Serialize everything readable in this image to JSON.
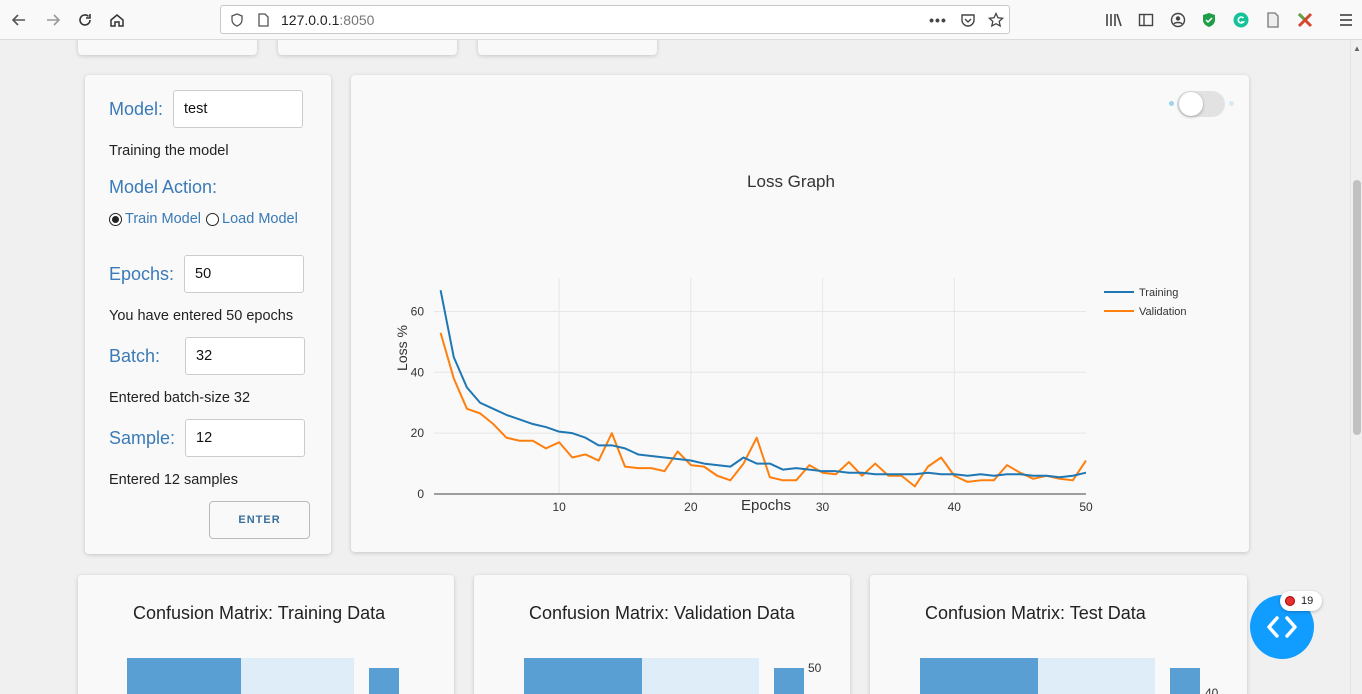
{
  "browser": {
    "url_host": "127.0.0.1",
    "url_port": ":8050"
  },
  "control_panel": {
    "model_label": "Model:",
    "model_value": "test",
    "model_status": "Training the model",
    "action_label": "Model Action:",
    "action_options": [
      "Train Model",
      "Load Model"
    ],
    "action_selected": "Train Model",
    "epochs_label": "Epochs:",
    "epochs_value": "50",
    "epochs_status": "You have entered 50 epochs",
    "batch_label": "Batch:",
    "batch_value": "32",
    "batch_status": "Entered batch-size 32",
    "sample_label": "Sample:",
    "sample_value": "12",
    "sample_status": "Entered 12 samples",
    "enter_label": "ENTER"
  },
  "toggle": {
    "on": false
  },
  "chart_data": {
    "type": "line",
    "title": "Loss Graph",
    "xlabel": "Epochs",
    "ylabel": "Loss %",
    "xlim": [
      0.5,
      50
    ],
    "ylim": [
      0,
      71
    ],
    "xticks": [
      10,
      20,
      30,
      40,
      50
    ],
    "yticks": [
      0,
      20,
      40,
      60
    ],
    "grid": true,
    "legend_position": "top-right",
    "x": [
      1,
      2,
      3,
      4,
      5,
      6,
      7,
      8,
      9,
      10,
      11,
      12,
      13,
      14,
      15,
      16,
      17,
      18,
      19,
      20,
      21,
      22,
      23,
      24,
      25,
      26,
      27,
      28,
      29,
      30,
      31,
      32,
      33,
      34,
      35,
      36,
      37,
      38,
      39,
      40,
      41,
      42,
      43,
      44,
      45,
      46,
      47,
      48,
      49,
      50
    ],
    "series": [
      {
        "name": "Training",
        "color": "#1f77b4",
        "values": [
          67,
          45,
          35,
          30,
          28,
          26,
          24.5,
          23,
          22,
          20.5,
          20,
          18.5,
          16,
          16,
          15,
          13,
          12.5,
          12,
          11.5,
          11,
          10,
          9.5,
          9,
          12,
          10,
          10,
          8,
          8.5,
          8,
          7.5,
          7.5,
          7,
          7,
          6.5,
          6.5,
          6.5,
          6.5,
          7,
          6.5,
          6.5,
          6,
          6.5,
          6,
          6.5,
          6.5,
          6,
          6,
          5.5,
          6,
          7
        ]
      },
      {
        "name": "Validation",
        "color": "#ff7f0e",
        "values": [
          53,
          38,
          28,
          26.5,
          23,
          18.5,
          17.5,
          17.5,
          15,
          17,
          12,
          13,
          11,
          20,
          9,
          8.5,
          8.5,
          7.5,
          14,
          9.5,
          9,
          6,
          4.5,
          10,
          18.5,
          5.5,
          4.5,
          4.5,
          9.5,
          7,
          6.5,
          10.5,
          6,
          10,
          6,
          6,
          2.5,
          9,
          12,
          6,
          4,
          4.5,
          4.5,
          9.5,
          7,
          5,
          6,
          5,
          4.5,
          11
        ]
      }
    ]
  },
  "confusion_matrices": [
    {
      "title": "Confusion Matrix: Training Data",
      "scale_label": ""
    },
    {
      "title": "Confusion Matrix: Validation Data",
      "scale_label": "50"
    },
    {
      "title": "Confusion Matrix: Test Data",
      "scale_label": "40"
    }
  ],
  "debug_widget": {
    "count": "19"
  }
}
